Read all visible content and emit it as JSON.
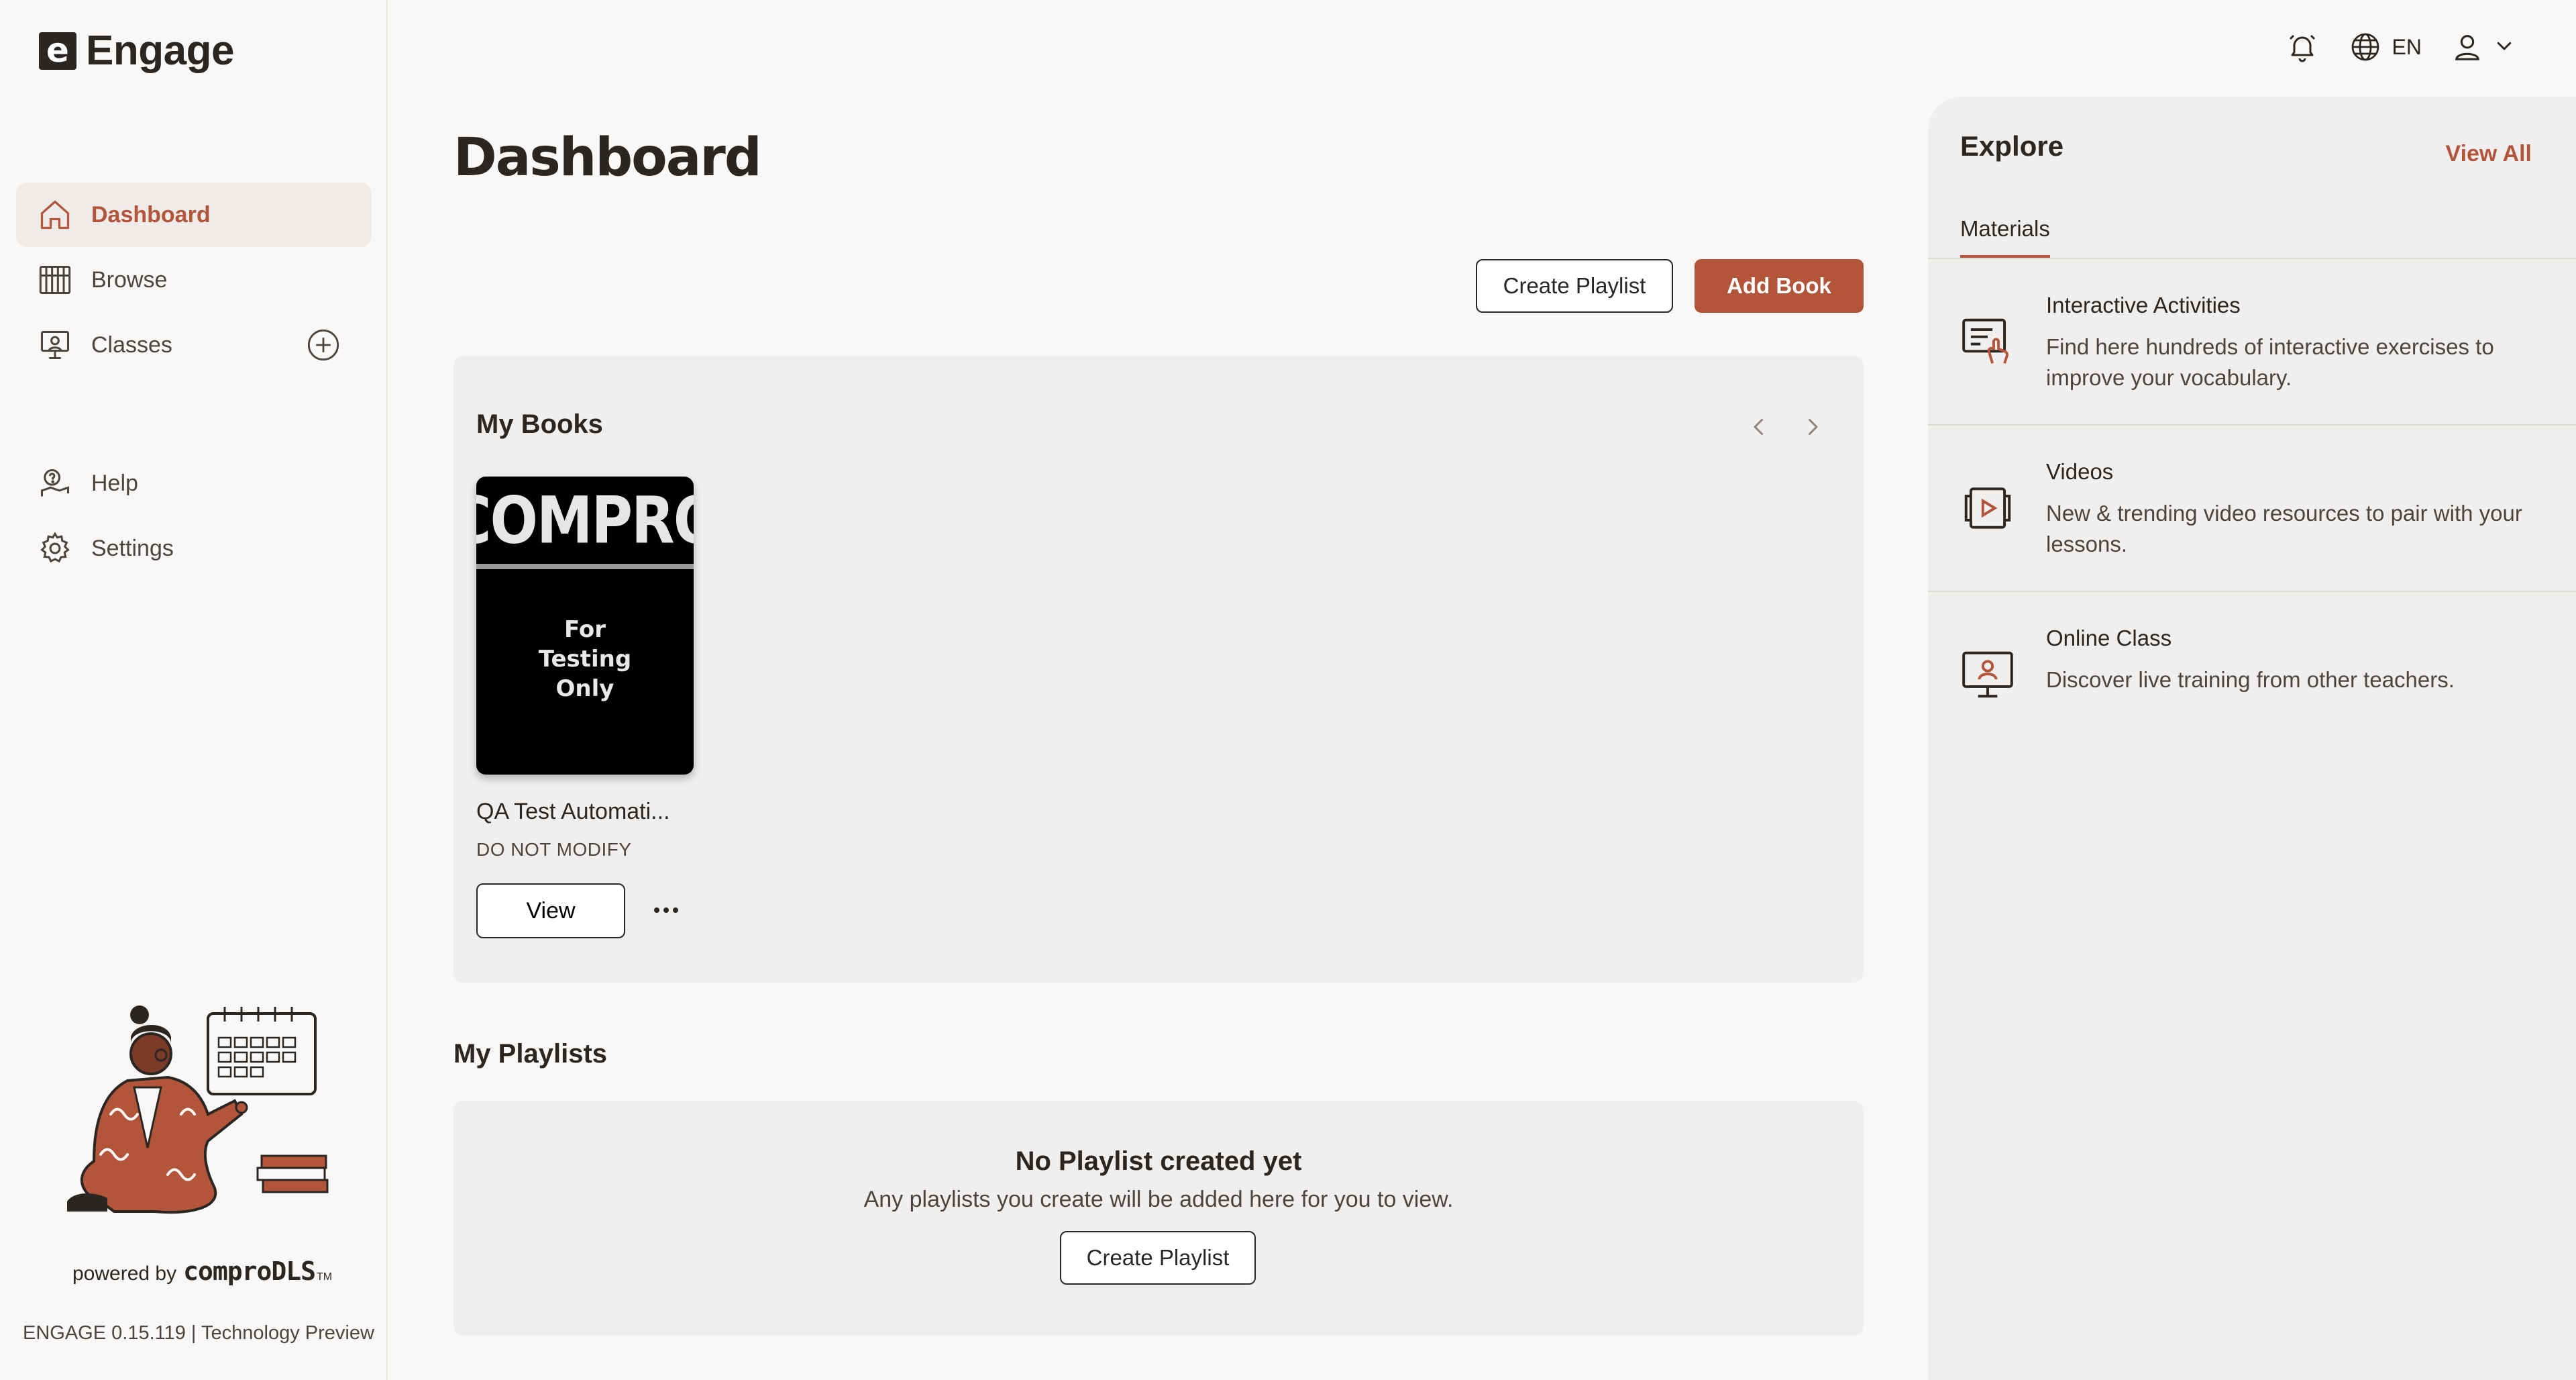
{
  "app": {
    "logo_letter": "e",
    "name": "Engage"
  },
  "sidebar": {
    "items": [
      {
        "label": "Dashboard",
        "icon": "home-icon",
        "active": true
      },
      {
        "label": "Browse",
        "icon": "library-icon",
        "active": false
      },
      {
        "label": "Classes",
        "icon": "classroom-icon",
        "active": false
      },
      {
        "label": "Help",
        "icon": "help-icon",
        "active": false
      },
      {
        "label": "Settings",
        "icon": "gear-icon",
        "active": false
      }
    ],
    "powered_by": "powered by",
    "powered_brand": "comproDLS",
    "powered_tm": "TM",
    "version": "ENGAGE 0.15.119 | Technology Preview"
  },
  "topbar": {
    "language": "EN"
  },
  "main": {
    "title": "Dashboard",
    "create_playlist_label": "Create Playlist",
    "add_book_label": "Add Book",
    "my_books": {
      "title": "My Books",
      "books": [
        {
          "cover_title": "COMPRO",
          "cover_subtitle": "For\nTesting\nOnly",
          "name": "QA Test Automati...",
          "subtitle": "DO NOT MODIFY",
          "view_label": "View"
        }
      ]
    },
    "my_playlists": {
      "title": "My Playlists",
      "empty_title": "No Playlist created yet",
      "empty_text": "Any playlists you create will be added here for you to view.",
      "create_label": "Create Playlist"
    }
  },
  "explore": {
    "title": "Explore",
    "view_all": "View All",
    "tab": "Materials",
    "items": [
      {
        "title": "Interactive Activities",
        "desc": "Find here hundreds of interactive exercises to improve your vocabulary.",
        "icon": "interactive-activities-icon"
      },
      {
        "title": "Videos",
        "desc": "New & trending video resources to pair with your lessons.",
        "icon": "videos-icon"
      },
      {
        "title": "Online Class",
        "desc": "Discover live training from other teachers.",
        "icon": "online-class-icon"
      }
    ]
  },
  "colors": {
    "accent": "#b2553a",
    "text": "#2a2624",
    "panel": "#f1efed",
    "background": "#faf8f6"
  }
}
